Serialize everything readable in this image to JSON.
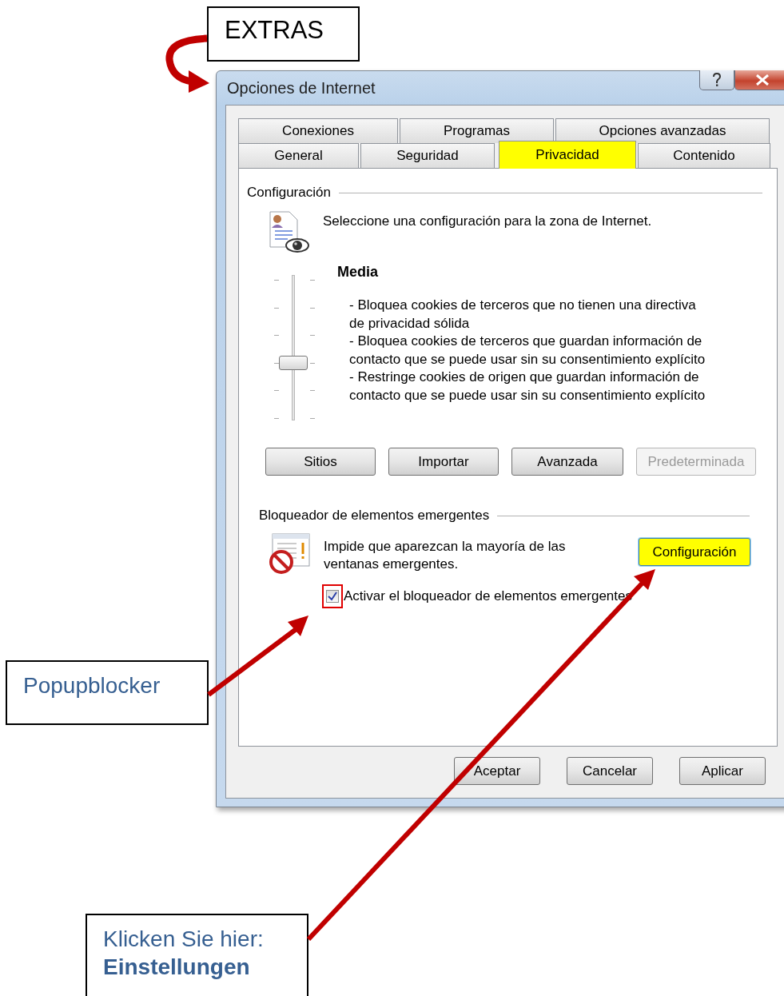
{
  "annotations": [
    {
      "kind": "plain",
      "text": "EXTRAS"
    },
    {
      "kind": "note",
      "text": "Popupblocker"
    },
    {
      "kind": "note",
      "text": "Klicken Sie hier: **Einstellungen**"
    }
  ],
  "window": {
    "title": "Opciones de Internet"
  },
  "tab_rows": [
    [
      {
        "label": "Conexiones",
        "selected": false,
        "highlight": false
      },
      {
        "label": "Programas",
        "selected": false,
        "highlight": false
      },
      {
        "label": "Opciones avanzadas",
        "selected": false,
        "highlight": false
      }
    ],
    [
      {
        "label": "General",
        "selected": false,
        "highlight": false
      },
      {
        "label": "Seguridad",
        "selected": false,
        "highlight": false
      },
      {
        "label": "Privacidad",
        "selected": true,
        "highlight": true
      },
      {
        "label": "Contenido",
        "selected": false,
        "highlight": false
      }
    ]
  ],
  "privacy": {
    "group_title": "Configuración",
    "intro": "Seleccione una configuración para la zona de Internet.",
    "slider": {
      "level": 0.4
    },
    "level_name": "Media",
    "description": [
      "- Bloquea cookies de terceros que no tienen una directiva de privacidad sólida",
      "- Bloquea cookies de terceros que guardan información de contacto que se puede usar sin su consentimiento explícito",
      "- Restringe cookies de origen que guardan información de contacto que se puede usar sin su consentimiento explícito"
    ],
    "buttons": [
      {
        "label": "Sitios",
        "disabled": false
      },
      {
        "label": "Importar",
        "disabled": false
      },
      {
        "label": "Avanzada",
        "disabled": false
      },
      {
        "label": "Predeterminada",
        "disabled": true
      }
    ]
  },
  "popup": {
    "group_title": "Bloqueador de elementos emergentes",
    "text": "Impide que aparezcan la mayoría de las ventanas emergentes.",
    "button": {
      "label": "Configuración",
      "highlight": true
    },
    "checkbox": {
      "label": "Activar el bloqueador de elementos emergentes",
      "checked": true,
      "highlight": true
    }
  },
  "footer_buttons": [
    "Aceptar",
    "Cancelar",
    "Aplicar"
  ]
}
